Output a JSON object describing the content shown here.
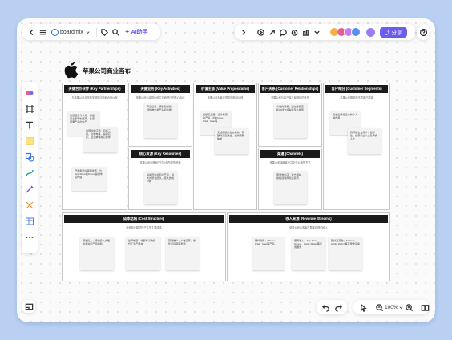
{
  "toolbar": {
    "back_icon": "chevron-left-icon",
    "menu_icon": "menu-icon",
    "brand": "boardmix",
    "ai_label": "AI助手",
    "share_label": "分享"
  },
  "canvas": {
    "title": "苹果公司商业画布",
    "zoom": "100%"
  },
  "sections": [
    {
      "id": "key-partnerships",
      "header": "关键合作伙伴 (Key Partnerships)",
      "desc": "与苹果公司合作的关键供应商和合作伙伴",
      "notes": [
        "供应链合作伙伴：包括富士康等制造商，负责苹果产品的生产",
        "零部件供应商：包括三星、台积电等，提供芯片、显示屏等核心部件",
        "开发者和内容提供商：为App Store和iCloud提供丰富内容"
      ]
    },
    {
      "id": "key-activities",
      "header": "关键业务 (Key Activities)",
      "desc": "苹果公司为实现价值主张而进行的核心活动",
      "notes": [
        "产品设计、研发和创新，持续推出新产品和功能"
      ]
    },
    {
      "id": "key-resources",
      "header": "核心资源 (Key Resources)",
      "desc": "苹果公司创造和交付价值所需的资源",
      "notes": [
        "品牌形象和知识产权，强大的研发团队，庞大的用户群"
      ]
    },
    {
      "id": "value-propositions",
      "header": "价值主张 (Value Propositions)",
      "desc": "苹果公司为客户提供的独特价值",
      "notes": [
        "提供高品质、设计精美的产品，如iPhone、iPad、Mac等",
        "无缝衔接的生态系统，软硬件深度整合，提供流畅体验"
      ]
    },
    {
      "id": "customer-relationships",
      "header": "客户关系 (Customer Relationships)",
      "desc": "苹果公司与客户建立和维护的关系",
      "notes": [
        "个性化服务：通过零售店和在线支持提供专业服务"
      ]
    },
    {
      "id": "channels",
      "header": "渠道 (Channels)",
      "desc": "苹果公司接触客户并交付价值的方式",
      "notes": [
        "苹果零售店、官方网站、授权经销商及运营商"
      ]
    },
    {
      "id": "customer-segments",
      "header": "客户细分 (Customer Segments)",
      "desc": "苹果公司服务的不同客户群体",
      "notes": [
        "追求品质和设计的个人消费者",
        "教育和企业用户，如学生、创意专业人士及商务人士"
      ]
    },
    {
      "id": "cost-structure",
      "header": "成本结构 (Cost Structure)",
      "desc": "运营商业模式所产生的主要成本",
      "notes": [
        "研发投入：持续投入大量资金进行产品创新",
        "生产制造：零部件采购和代工生产成本",
        "营销推广：广告宣传、零售店运营等费用"
      ]
    },
    {
      "id": "revenue-streams",
      "header": "收入来源 (Revenue Streams)",
      "desc": "苹果公司从各客户群体获得的收入",
      "notes": [
        "硬件销售：iPhone、iPad、Mac等产品",
        "服务收入：App Store、iCloud、Apple Music等订阅服务",
        "配件及其他：AirPods、Apple Watch等可穿戴设备"
      ]
    }
  ]
}
